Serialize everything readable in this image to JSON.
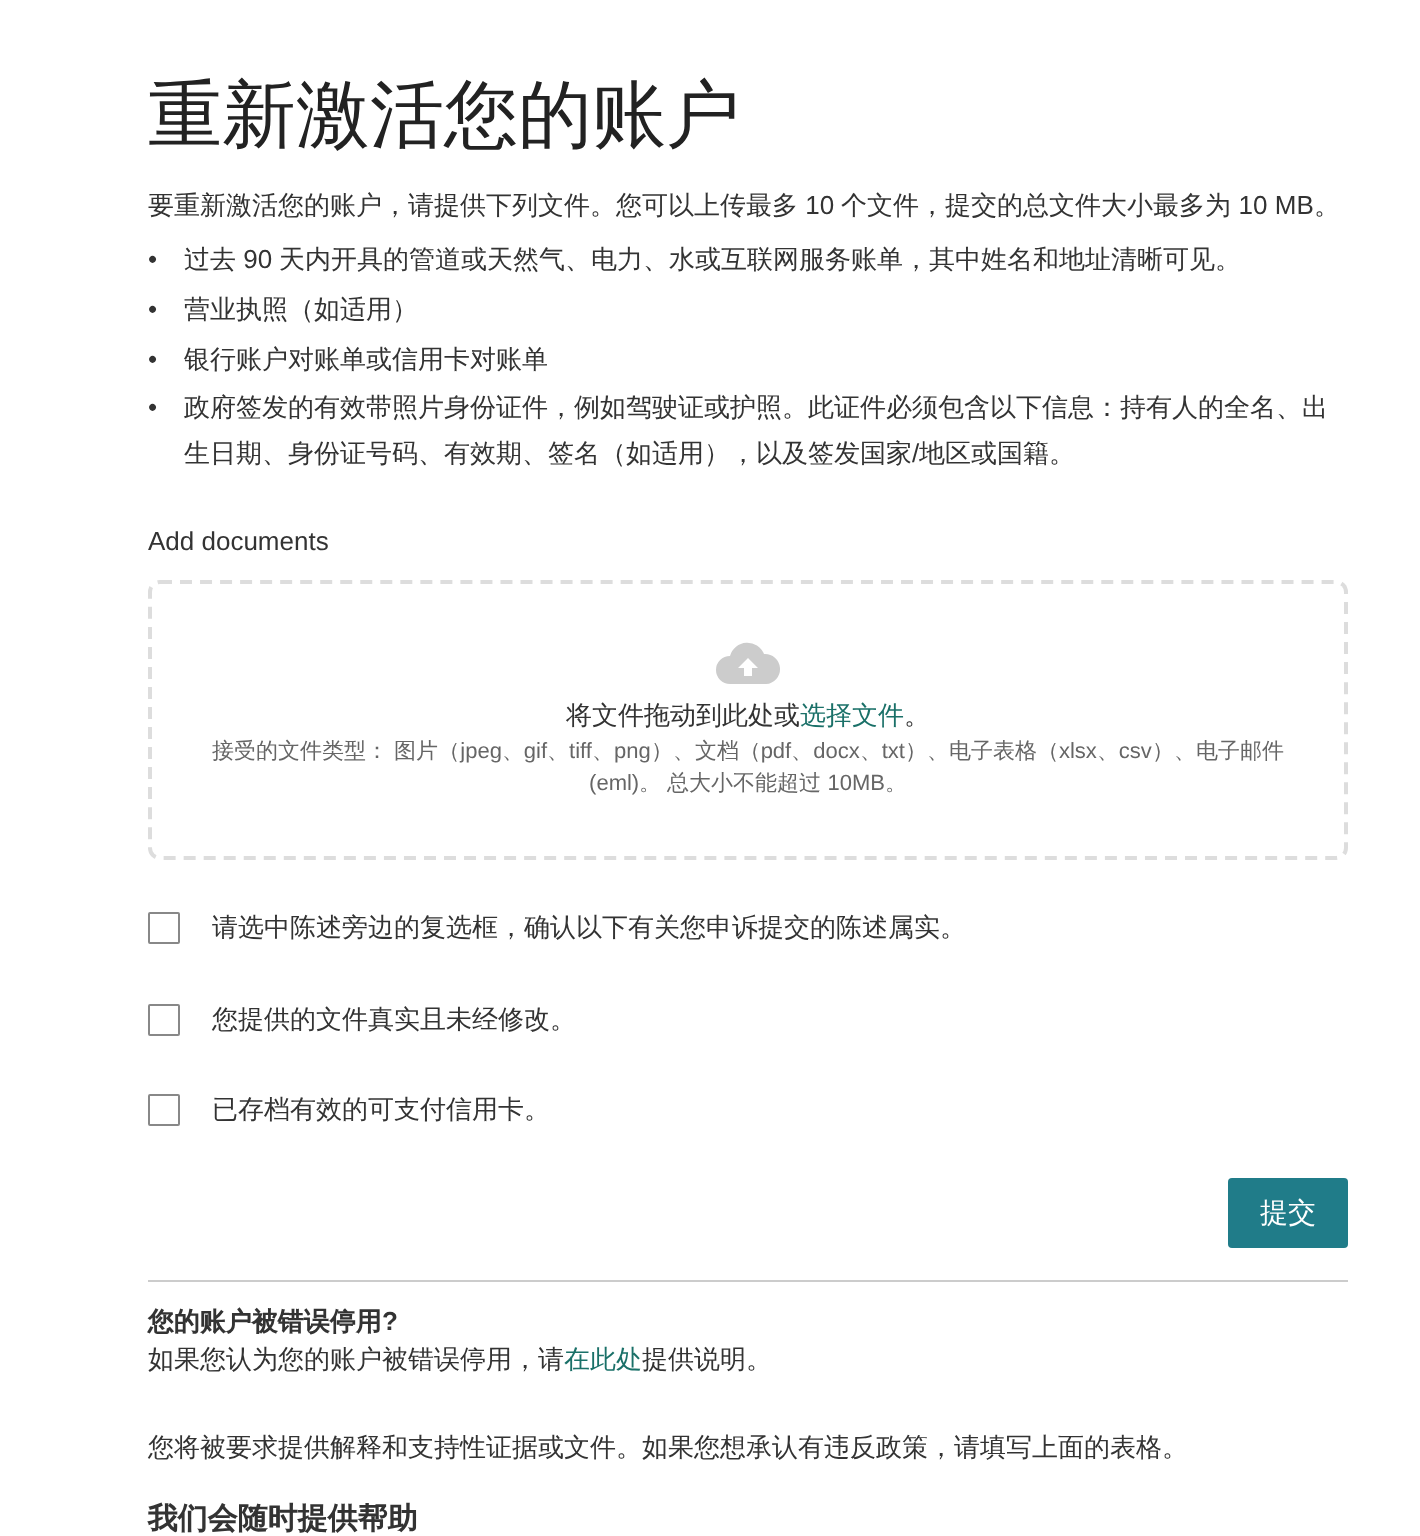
{
  "title": "重新激活您的账户",
  "intro": "要重新激活您的账户，请提供下列文件。您可以上传最多 10 个文件，提交的总文件大小最多为 10 MB。",
  "documents": [
    {
      "bullet": "•",
      "text": "过去 90 天内开具的管道或天然气、电力、水或互联网服务账单，其中姓名和地址清晰可见。"
    },
    {
      "bullet": "•",
      "text": "营业执照（如适用）"
    },
    {
      "bullet": "•",
      "text": "银行账户对账单或信用卡对账单"
    },
    {
      "bullet": "•",
      "text": "政府签发的有效带照片身份证件，例如驾驶证或护照。此证件必须包含以下信息：持有人的全名、出生日期、身份证号码、有效期、签名（如适用），以及签发国家/地区或国籍。"
    }
  ],
  "upload": {
    "label": "Add documents",
    "prompt_before": "将文件拖动到此处或",
    "prompt_link": "选择文件",
    "prompt_after": "。",
    "accepted": "接受的文件类型： 图片（jpeg、gif、tiff、png）、文档（pdf、docx、txt）、电子表格（xlsx、csv）、电子邮件 (eml)。 总大小不能超过 10MB。"
  },
  "statements": [
    {
      "label": "请选中陈述旁边的复选框，确认以下有关您申诉提交的陈述属实。",
      "checked": false
    },
    {
      "label": "您提供的文件真实且未经修改。",
      "checked": false
    },
    {
      "label": "已存档有效的可支付信用卡。",
      "checked": false
    }
  ],
  "submit": "提交",
  "wrongly": {
    "heading": "您的账户被错误停用?",
    "text_before": "如果您认为您的账户被错误停用，请",
    "link": "在此处",
    "text_after": "提供说明。",
    "note": "您将被要求提供解释和支持性证据或文件。如果您想承认有违反政策，请填写上面的表格。"
  },
  "help": {
    "heading": "我们会随时提供帮助"
  }
}
